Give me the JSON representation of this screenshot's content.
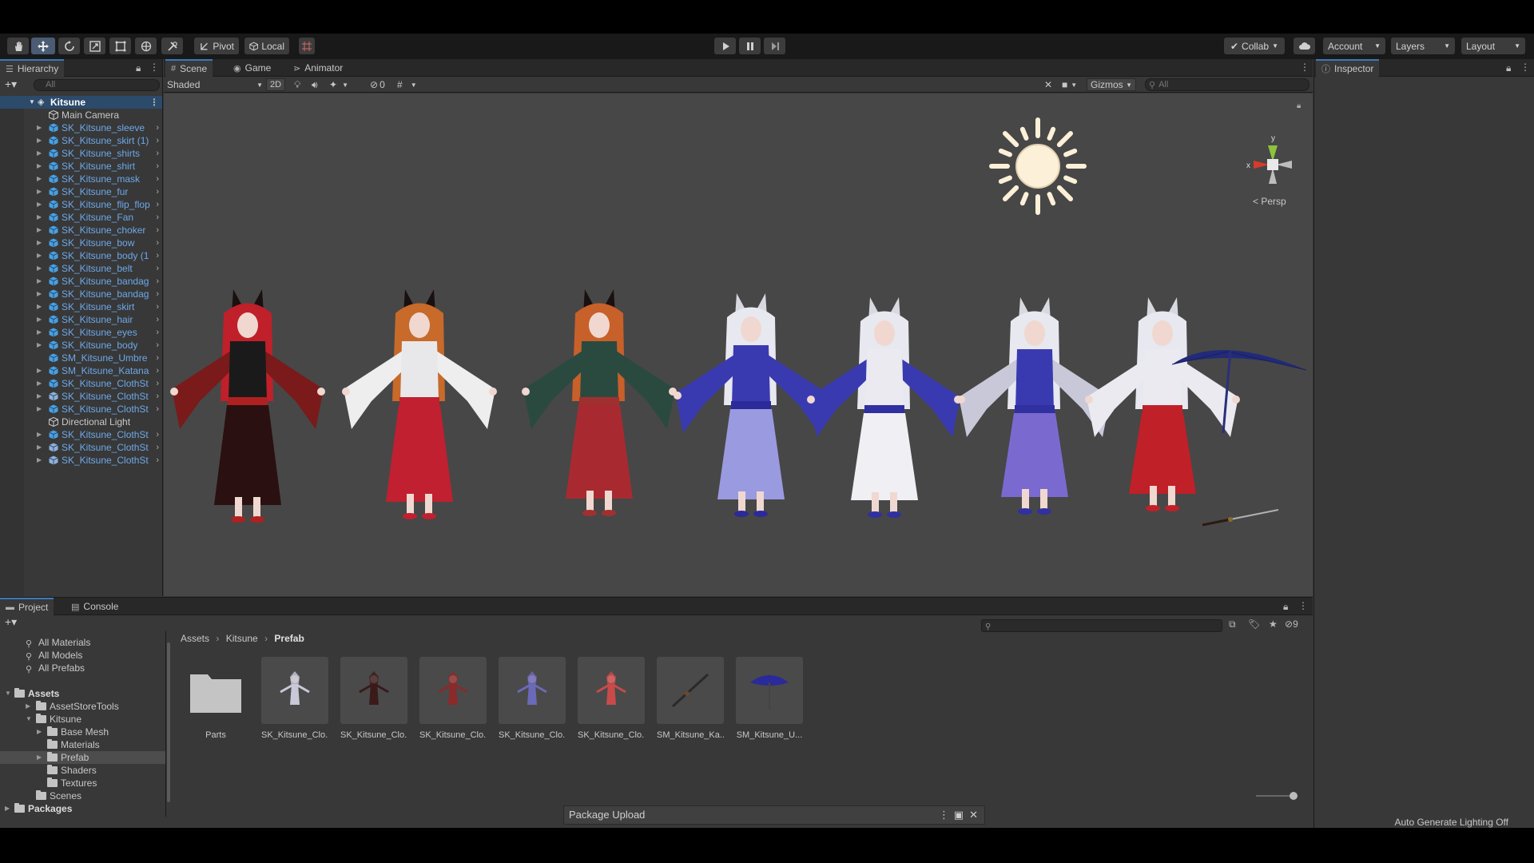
{
  "toolbar": {
    "pivot": "Pivot",
    "local": "Local",
    "collab": "Collab",
    "account": "Account",
    "layers": "Layers",
    "layout": "Layout"
  },
  "hierarchy": {
    "tab": "Hierarchy",
    "search_placeholder": "All",
    "root": "Kitsune",
    "items": [
      {
        "label": "Main Camera",
        "type": "go",
        "blue": false,
        "expand": false
      },
      {
        "label": "SK_Kitsune_sleeve",
        "type": "prefab",
        "blue": true,
        "expand": true
      },
      {
        "label": "SK_Kitsune_skirt (1)",
        "type": "prefab",
        "blue": true,
        "expand": true
      },
      {
        "label": "SK_Kitsune_shirts",
        "type": "prefab",
        "blue": true,
        "expand": true
      },
      {
        "label": "SK_Kitsune_shirt",
        "type": "prefab",
        "blue": true,
        "expand": true
      },
      {
        "label": "SK_Kitsune_mask",
        "type": "prefab",
        "blue": true,
        "expand": true
      },
      {
        "label": "SK_Kitsune_fur",
        "type": "prefab",
        "blue": true,
        "expand": true
      },
      {
        "label": "SK_Kitsune_flip_flop",
        "type": "prefab",
        "blue": true,
        "expand": true
      },
      {
        "label": "SK_Kitsune_Fan",
        "type": "prefab",
        "blue": true,
        "expand": true
      },
      {
        "label": "SK_Kitsune_choker",
        "type": "prefab",
        "blue": true,
        "expand": true
      },
      {
        "label": "SK_Kitsune_bow",
        "type": "prefab",
        "blue": true,
        "expand": true
      },
      {
        "label": "SK_Kitsune_body (1",
        "type": "prefab",
        "blue": true,
        "expand": true
      },
      {
        "label": "SK_Kitsune_belt",
        "type": "prefab",
        "blue": true,
        "expand": true
      },
      {
        "label": "SK_Kitsune_bandag",
        "type": "prefab",
        "blue": true,
        "expand": true
      },
      {
        "label": "SK_Kitsune_bandag",
        "type": "prefab",
        "blue": true,
        "expand": true
      },
      {
        "label": "SK_Kitsune_skirt",
        "type": "prefab",
        "blue": true,
        "expand": true
      },
      {
        "label": "SK_Kitsune_hair",
        "type": "prefab",
        "blue": true,
        "expand": true
      },
      {
        "label": "SK_Kitsune_eyes",
        "type": "prefab",
        "blue": true,
        "expand": true
      },
      {
        "label": "SK_Kitsune_body",
        "type": "prefab",
        "blue": true,
        "expand": true
      },
      {
        "label": "SM_Kitsune_Umbre",
        "type": "prefab",
        "blue": true,
        "expand": false
      },
      {
        "label": "SM_Kitsune_Katana",
        "type": "prefab",
        "blue": true,
        "expand": true
      },
      {
        "label": "SK_Kitsune_ClothSt",
        "type": "prefab",
        "blue": true,
        "expand": true
      },
      {
        "label": "SK_Kitsune_ClothSt",
        "type": "variant",
        "blue": true,
        "expand": true
      },
      {
        "label": "SK_Kitsune_ClothSt",
        "type": "prefab",
        "blue": true,
        "expand": true
      },
      {
        "label": "Directional Light",
        "type": "go",
        "blue": false,
        "expand": false
      },
      {
        "label": "SK_Kitsune_ClothSt",
        "type": "prefab",
        "blue": true,
        "expand": true
      },
      {
        "label": "SK_Kitsune_ClothSt",
        "type": "variant",
        "blue": true,
        "expand": true
      },
      {
        "label": "SK_Kitsune_ClothSt",
        "type": "variant",
        "blue": true,
        "expand": true
      }
    ]
  },
  "scene": {
    "tabs": [
      "Scene",
      "Game",
      "Animator"
    ],
    "shading": "Shaded",
    "mode_2d": "2D",
    "hidden_count": "0",
    "gizmos": "Gizmos",
    "search_placeholder": "All",
    "persp": "Persp",
    "axis_x": "x",
    "axis_y": "y"
  },
  "inspector": {
    "tab": "Inspector"
  },
  "project": {
    "tabs": [
      "Project",
      "Console"
    ],
    "hidden_count": "9",
    "favorites": [
      "All Materials",
      "All Models",
      "All Prefabs"
    ],
    "assets_label": "Assets",
    "tree": [
      {
        "label": "AssetStoreTools",
        "indent": 1,
        "arrow": "right"
      },
      {
        "label": "Kitsune",
        "indent": 1,
        "arrow": "down"
      },
      {
        "label": "Base Mesh",
        "indent": 2,
        "arrow": "right"
      },
      {
        "label": "Materials",
        "indent": 2,
        "arrow": ""
      },
      {
        "label": "Prefab",
        "indent": 2,
        "arrow": "right",
        "selected": true
      },
      {
        "label": "Shaders",
        "indent": 2,
        "arrow": ""
      },
      {
        "label": "Textures",
        "indent": 2,
        "arrow": ""
      },
      {
        "label": "Scenes",
        "indent": 1,
        "arrow": ""
      }
    ],
    "packages_label": "Packages",
    "breadcrumb": [
      "Assets",
      "Kitsune",
      "Prefab"
    ],
    "assets": [
      {
        "label": "Parts",
        "kind": "folder"
      },
      {
        "label": "SK_Kitsune_Clo...",
        "kind": "char",
        "color": "#c8c8d8"
      },
      {
        "label": "SK_Kitsune_Clo...",
        "kind": "char",
        "color": "#3a1a1a"
      },
      {
        "label": "SK_Kitsune_Clo...",
        "kind": "char",
        "color": "#8a2a2a"
      },
      {
        "label": "SK_Kitsune_Clo...",
        "kind": "char",
        "color": "#6a6ab8"
      },
      {
        "label": "SK_Kitsune_Clo...",
        "kind": "char",
        "color": "#c84a4a"
      },
      {
        "label": "SM_Kitsune_Ka...",
        "kind": "katana",
        "color": "#222"
      },
      {
        "label": "SM_Kitsune_U...",
        "kind": "umbrella",
        "color": "#2a2a8a"
      }
    ]
  },
  "package_upload": "Package Upload",
  "status": {
    "lighting": "Auto Generate Lighting Off"
  },
  "characters": [
    {
      "hair": "#c0202a",
      "top": "#1a1a1a",
      "bottom": "#2a1010",
      "sleeve": "#7a1a1a",
      "accent": "#b02020"
    },
    {
      "hair": "#c86a2a",
      "top": "#e8e8ea",
      "bottom": "#c02030",
      "sleeve": "#eeeeee",
      "accent": "#c02030"
    },
    {
      "hair": "#c8602a",
      "top": "#2a4a40",
      "bottom": "#a82a30",
      "sleeve": "#2a4a40",
      "accent": "#a03030"
    },
    {
      "hair": "#e8e8f0",
      "top": "#3a3ab0",
      "bottom": "#9a9ae0",
      "sleeve": "#3a3ab0",
      "accent": "#2a2a9a"
    },
    {
      "hair": "#e8e8f0",
      "top": "#eaeaf0",
      "bottom": "#f0f0f4",
      "sleeve": "#3a3ab0",
      "accent": "#3030a0"
    },
    {
      "hair": "#e8e8f0",
      "top": "#3a3ab0",
      "bottom": "#7a6ad0",
      "sleeve": "#c8c8d8",
      "accent": "#3030a0"
    },
    {
      "hair": "#e8e8f0",
      "top": "#eaeaf0",
      "bottom": "#c02028",
      "sleeve": "#eaeaf0",
      "accent": "#c02028"
    }
  ]
}
